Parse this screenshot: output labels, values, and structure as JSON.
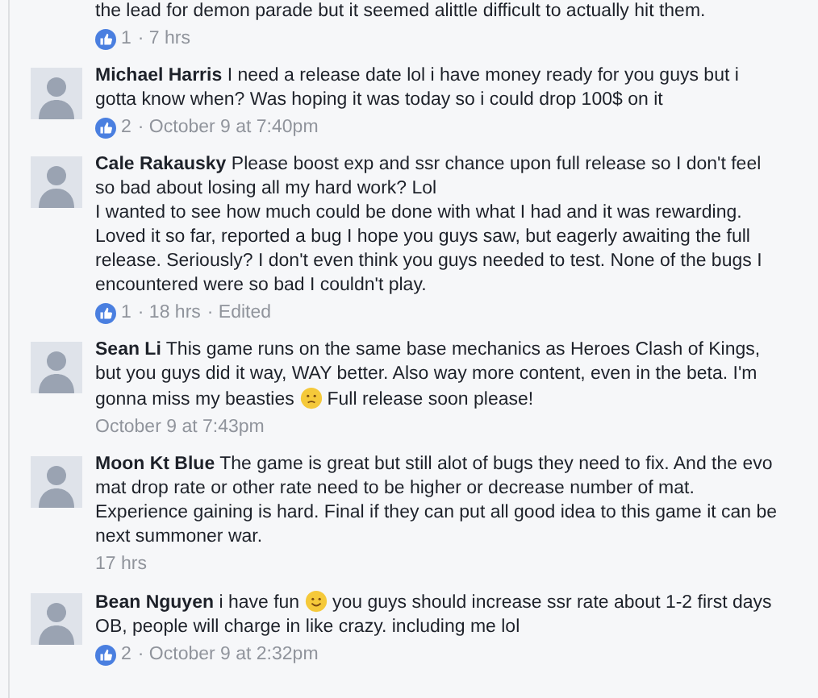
{
  "top_comment": {
    "body": "the lead for demon parade but it seemed alittle difficult to actually hit them.",
    "reactions": {
      "count": "1"
    },
    "info": [
      "· 7 hrs"
    ]
  },
  "comments": [
    {
      "author": "Michael Harris",
      "body": [
        {
          "kind": "text",
          "text": "I need a release date lol i have money ready for you guys but i gotta know when? Was hoping it was today so i could drop 100$ on it"
        }
      ],
      "reactions": {
        "count": "2"
      },
      "info": [
        "· October 9 at 7:40pm"
      ]
    },
    {
      "author": "Cale Rakausky",
      "body": [
        {
          "kind": "text",
          "text": "Please boost exp and ssr chance upon full release so I don't feel so bad about losing all my hard work? Lol\nI wanted to see how much could be done with what I had and it was rewarding. Loved it so far, reported a bug I hope you guys saw, but eagerly awaiting the full release. Seriously? I don't even think you guys needed to test. None of the bugs I encountered were so bad I couldn't play."
        }
      ],
      "reactions": {
        "count": "1"
      },
      "info": [
        "· 18 hrs",
        "· Edited"
      ]
    },
    {
      "author": "Sean Li",
      "body": [
        {
          "kind": "text",
          "text": "This game runs on the same base mechanics as Heroes Clash of Kings, but you guys did it way, WAY better. Also way more content, even in the beta. I'm gonna miss my beasties "
        },
        {
          "kind": "sad-emoji"
        },
        {
          "kind": "text",
          "text": " Full release soon please!"
        }
      ],
      "info": [
        "October 9 at 7:43pm"
      ]
    },
    {
      "author": "Moon Kt Blue",
      "body": [
        {
          "kind": "text",
          "text": "The game is great but still alot of bugs they need to fix. And the evo mat drop rate or other rate need to be higher or decrease number of mat. Experience gaining is hard. Final if they can put all good idea to this game it can be next summoner war."
        }
      ],
      "info": [
        "17 hrs"
      ]
    },
    {
      "author": "Bean Nguyen",
      "body": [
        {
          "kind": "text",
          "text": "i have fun "
        },
        {
          "kind": "smile-emoji"
        },
        {
          "kind": "text",
          "text": " you guys should increase ssr rate about 1-2 first days OB, people will charge in like crazy. including me lol"
        }
      ],
      "reactions": {
        "count": "2"
      },
      "info": [
        "· October 9 at 2:32pm"
      ]
    }
  ]
}
